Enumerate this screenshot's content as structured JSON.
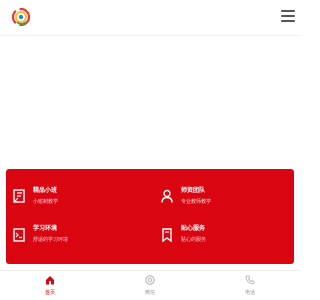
{
  "colors": {
    "brand_red": "#d90612",
    "header_bg": "#ffffff",
    "text_muted": "#999999"
  },
  "header": {
    "logo_icon": "brand-logo-icon",
    "menu_icon": "hamburger-menu-icon"
  },
  "features": [
    {
      "title": "精品小班",
      "subtitle": "小班制教学",
      "icon": "certificate-icon"
    },
    {
      "title": "师资团队",
      "subtitle": "专业教师教学",
      "icon": "user-icon"
    },
    {
      "title": "学习环境",
      "subtitle": "舒适的学习环境",
      "icon": "chalkboard-icon"
    },
    {
      "title": "贴心服务",
      "subtitle": "贴心的服务",
      "icon": "bookmark-icon"
    }
  ],
  "bottom_nav": [
    {
      "label": "首页",
      "icon": "home-icon",
      "active": true
    },
    {
      "label": "微信",
      "icon": "wechat-icon",
      "active": false
    },
    {
      "label": "电话",
      "icon": "phone-icon",
      "active": false
    }
  ]
}
